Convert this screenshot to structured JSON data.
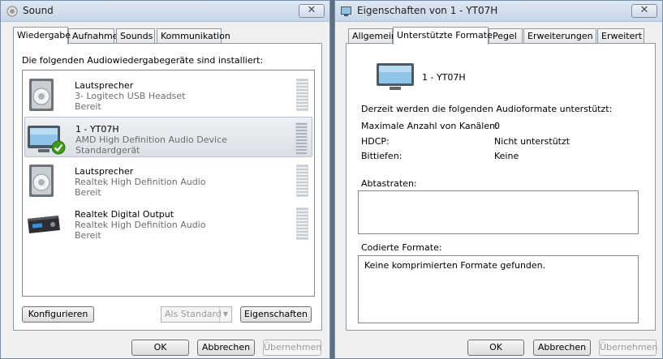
{
  "sound": {
    "title": "Sound",
    "close": "✕",
    "tabs": [
      "Wiedergabe",
      "Aufnahme",
      "Sounds",
      "Kommunikation"
    ],
    "instruction": "Die folgenden Audiowiedergabegeräte sind installiert:",
    "devices": [
      {
        "name": "Lautsprecher",
        "description": "3- Logitech USB Headset",
        "status": "Bereit",
        "icon": "speaker-icon"
      },
      {
        "name": "1 - YT07H",
        "description": "AMD High Definition Audio Device",
        "status": "Standardgerät",
        "icon": "monitor-icon",
        "default": true
      },
      {
        "name": "Lautsprecher",
        "description": "Realtek High Definition Audio",
        "status": "Bereit",
        "icon": "speaker-icon"
      },
      {
        "name": "Realtek Digital Output",
        "description": "Realtek High Definition Audio",
        "status": "Bereit",
        "icon": "receiver-icon"
      }
    ],
    "buttons": {
      "configure": "Konfigurieren",
      "set_default": "Als Standard",
      "properties": "Eigenschaften",
      "ok": "OK",
      "cancel": "Abbrechen",
      "apply": "Übernehmen"
    }
  },
  "props": {
    "title": "Eigenschaften von 1 - YT07H",
    "close": "✕",
    "tabs": [
      "Allgemein",
      "Unterstützte Formate",
      "Pegel",
      "Erweiterungen",
      "Erweitert"
    ],
    "device_name": "1 - YT07H",
    "intro": "Derzeit werden die folgenden Audioformate unterstützt:",
    "fields": [
      {
        "label": "Maximale Anzahl von Kanälen:",
        "value": "0"
      },
      {
        "label": "HDCP:",
        "value": "Nicht unterstützt"
      },
      {
        "label": "Bittiefen:",
        "value": "Keine"
      }
    ],
    "sample_rates_label": "Abtastraten:",
    "encoded_label": "Codierte Formate:",
    "encoded_text": "Keine komprimierten Formate gefunden.",
    "buttons": {
      "ok": "OK",
      "cancel": "Abbrechen",
      "apply": "Übernehmen"
    }
  },
  "colors": {
    "titlebar": "#c7d6e8",
    "accent": "#3f9a1e"
  }
}
